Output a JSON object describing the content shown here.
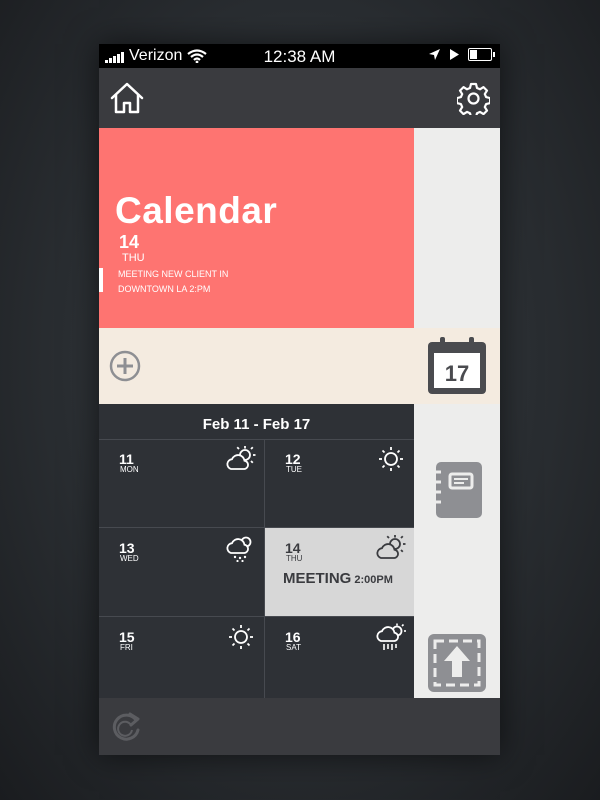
{
  "status_bar": {
    "carrier": "Verizon",
    "time": "12:38 AM",
    "battery_level": 0.35
  },
  "header": {
    "left_icon": "home-icon",
    "right_icon": "gear-icon"
  },
  "calendar_tile": {
    "title": "Calendar",
    "day_number": "14",
    "day_of_week": "THU",
    "event_line1": "MEETING NEW CLIENT IN",
    "event_line2": "DOWNTOWN LA 2:PM",
    "background_color": "#fe7471"
  },
  "sidebar": {
    "calendar_icon_day": "17",
    "icons": [
      "calendar-icon",
      "notes-icon",
      "upload-icon"
    ]
  },
  "add_row": {
    "icon": "plus-circle-icon"
  },
  "week": {
    "title": "Feb 11 - Feb 17",
    "days": [
      {
        "num": "11",
        "dow": "MON",
        "weather": "partly-cloudy-icon"
      },
      {
        "num": "12",
        "dow": "TUE",
        "weather": "sun-icon"
      },
      {
        "num": "13",
        "dow": "WED",
        "weather": "snow-icon"
      },
      {
        "num": "14",
        "dow": "THU",
        "weather": "partly-cloudy-icon",
        "event": "MEETING",
        "event_time": "2:00PM"
      },
      {
        "num": "15",
        "dow": "FRI",
        "weather": "sun-icon"
      },
      {
        "num": "16",
        "dow": "SAT",
        "weather": "rain-sun-icon"
      }
    ]
  },
  "footer": {
    "icon": "refresh-icon"
  }
}
